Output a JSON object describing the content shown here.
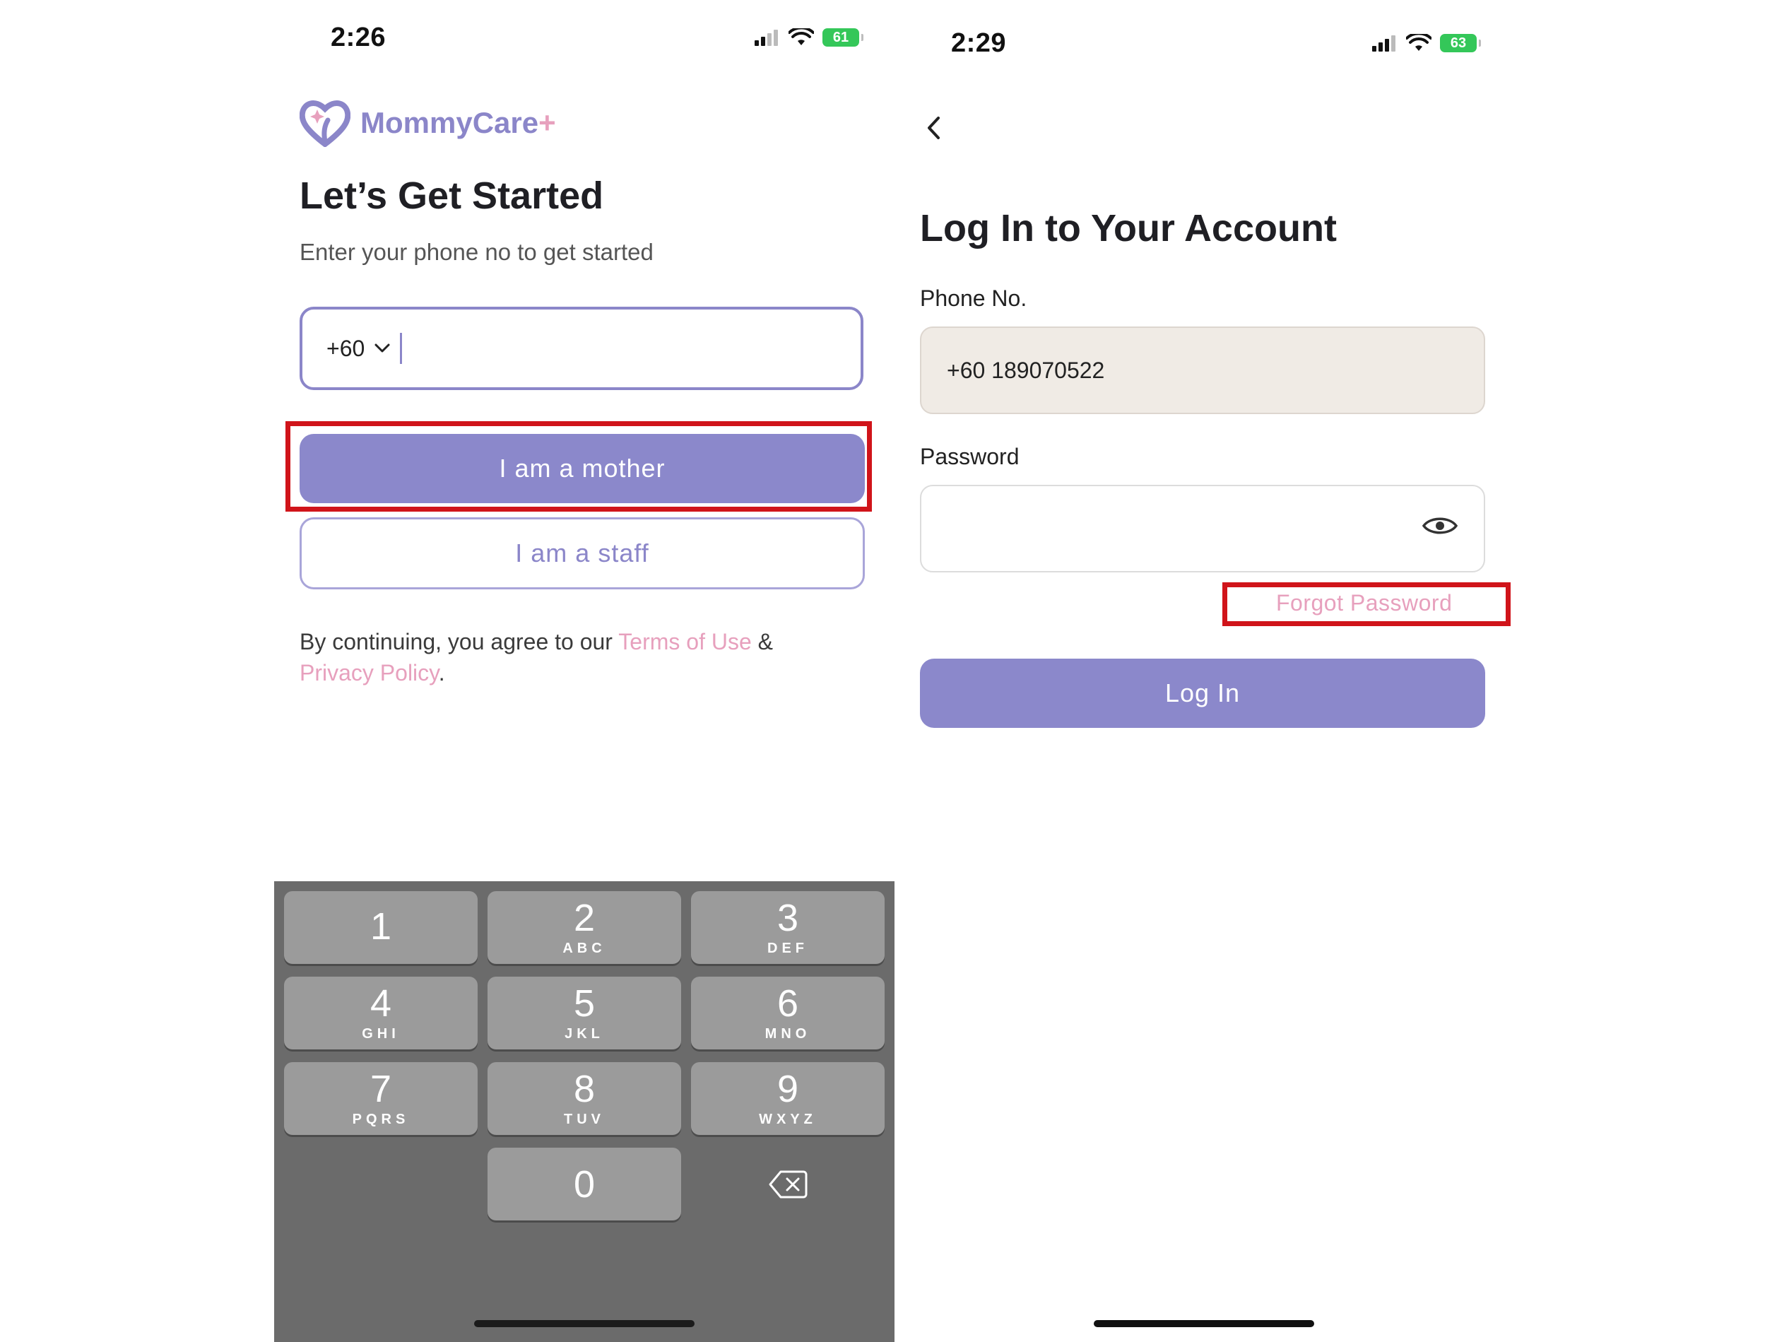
{
  "left_screen": {
    "status_bar": {
      "time": "2:26",
      "battery": "61"
    },
    "logo": {
      "name": "MommyCare",
      "plus": "+"
    },
    "title": "Let’s Get Started",
    "subtitle": "Enter your phone no to get started",
    "phone_input": {
      "country_code": "+60",
      "value": ""
    },
    "buttons": {
      "mother": "I am a mother",
      "staff": "I am a staff"
    },
    "terms": {
      "prefix": "By continuing, you agree to our ",
      "terms_link": "Terms of Use",
      "amp": " & ",
      "privacy_link": "Privacy Policy",
      "suffix": "."
    },
    "keypad": [
      {
        "num": "1",
        "letters": ""
      },
      {
        "num": "2",
        "letters": "ABC"
      },
      {
        "num": "3",
        "letters": "DEF"
      },
      {
        "num": "4",
        "letters": "GHI"
      },
      {
        "num": "5",
        "letters": "JKL"
      },
      {
        "num": "6",
        "letters": "MNO"
      },
      {
        "num": "7",
        "letters": "PQRS"
      },
      {
        "num": "8",
        "letters": "TUV"
      },
      {
        "num": "9",
        "letters": "WXYZ"
      },
      {
        "num": "0",
        "letters": ""
      }
    ]
  },
  "right_screen": {
    "status_bar": {
      "time": "2:29",
      "battery": "63"
    },
    "title": "Log In to Your Account",
    "phone_label": "Phone No.",
    "phone_value": "+60 189070522",
    "password_label": "Password",
    "password_value": "",
    "forgot_password": "Forgot Password",
    "login_button": "Log In"
  },
  "colors": {
    "accent": "#8b88cb",
    "pink_link": "#e7a0bd",
    "highlight_box": "#d0141a",
    "filled_input_bg": "#f0ebe5",
    "keyboard_bg": "#6b6b6b"
  },
  "icons": [
    "heart-logo-icon",
    "chevron-down-icon",
    "signal-icon",
    "wifi-icon",
    "battery-icon",
    "back-arrow-icon",
    "eye-icon",
    "delete-key-icon"
  ]
}
